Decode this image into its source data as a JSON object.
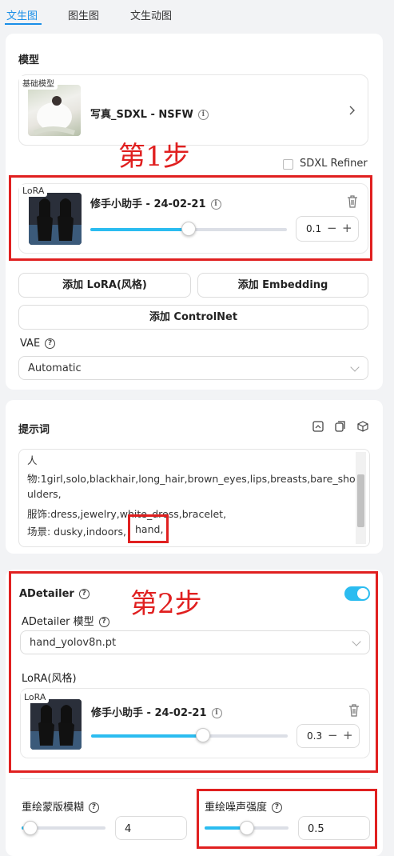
{
  "tabs": [
    {
      "label": "文生图",
      "active": true
    },
    {
      "label": "图生图",
      "active": false
    },
    {
      "label": "文生动图",
      "active": false
    }
  ],
  "model_section": {
    "title": "模型",
    "base_tag": "基础模型",
    "model_name": "写真_SDXL - NSFW",
    "refiner_label": "SDXL Refiner",
    "refiner_checked": false
  },
  "lora1": {
    "tag": "LoRA",
    "name": "修手小助手 - 24-02-21",
    "weight": "0.1",
    "weight_fraction": 0.5
  },
  "buttons": {
    "add_lora": "添加 LoRA(风格)",
    "add_embedding": "添加 Embedding",
    "add_controlnet": "添加 ControlNet"
  },
  "vae": {
    "label": "VAE",
    "value": "Automatic"
  },
  "prompt_section": {
    "title": "提示词",
    "lines": [
      "人",
      "物:1girl,solo,blackhair,long_hair,brown_eyes,lips,breasts,bare_sho",
      "ulders,",
      "服饰:dress,jewelry,white_dress,bracelet,",
      "场景: dusky,indoors,"
    ],
    "highlight_word": "hand,"
  },
  "adetailer": {
    "title": "ADetailer",
    "enabled": true,
    "model_label": "ADetailer 模型",
    "model_value": "hand_yolov8n.pt",
    "lora_label": "LoRA(风格)"
  },
  "lora2": {
    "tag": "LoRA",
    "name": "修手小助手 - 24-02-21",
    "weight": "0.3",
    "weight_fraction": 0.57
  },
  "mask_blur": {
    "label": "重绘蒙版模糊",
    "value": "4",
    "fraction": 0.1
  },
  "denoise": {
    "label": "重绘噪声强度",
    "value": "0.5",
    "fraction": 0.5
  },
  "annotations": {
    "step1": "第1步",
    "step2": "第2步"
  },
  "colors": {
    "accent": "#1a8fe8",
    "slider": "#2bbcf0",
    "annotation_red": "#e02020"
  }
}
